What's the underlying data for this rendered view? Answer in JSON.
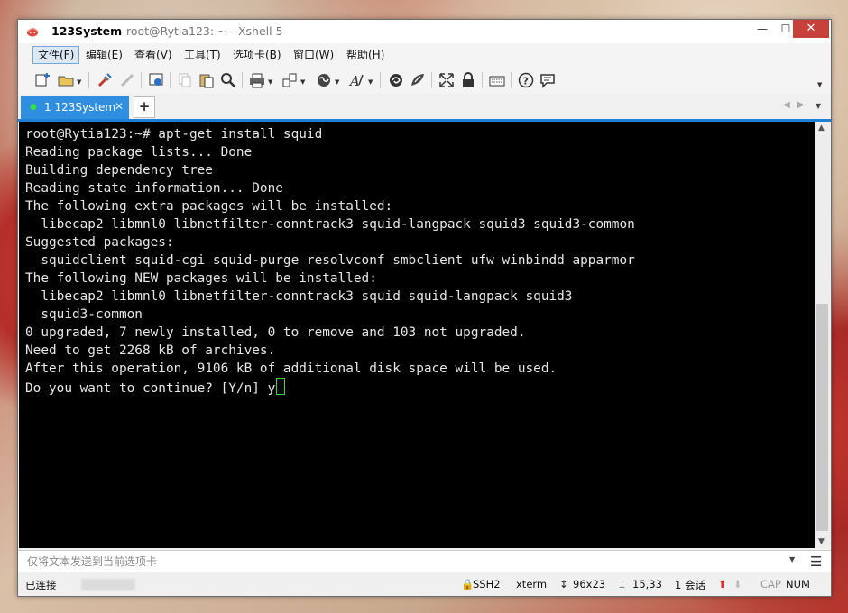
{
  "window": {
    "app_name": "123System",
    "title": "root@Rytia123: ~ - Xshell 5",
    "controls": {
      "minimize": "—",
      "maximize": "☐",
      "close": "✕"
    }
  },
  "menu": [
    {
      "label": "文件(F)",
      "active": true
    },
    {
      "label": "编辑(E)"
    },
    {
      "label": "查看(V)"
    },
    {
      "label": "工具(T)"
    },
    {
      "label": "选项卡(B)"
    },
    {
      "label": "窗口(W)"
    },
    {
      "label": "帮助(H)"
    }
  ],
  "toolbar_icons": [
    "new-session-icon",
    "open-folder-icon",
    "reconnect-icon",
    "disconnect-icon",
    "session-properties-icon",
    "copy-icon",
    "paste-icon",
    "find-icon",
    "print-icon",
    "transfer-icon",
    "globe-icon",
    "font-icon",
    "xftp-icon",
    "xmanager-icon",
    "fullscreen-icon",
    "lock-icon",
    "keyboard-icon",
    "help-icon",
    "chat-icon"
  ],
  "tabs": [
    {
      "label": "1 123System",
      "status_color": "#35e04a",
      "active": true
    }
  ],
  "tab_add": "+",
  "terminal": {
    "lines": [
      "root@Rytia123:~# apt-get install squid",
      "Reading package lists... Done",
      "Building dependency tree",
      "Reading state information... Done",
      "The following extra packages will be installed:",
      "  libecap2 libmnl0 libnetfilter-conntrack3 squid-langpack squid3 squid3-common",
      "Suggested packages:",
      "  squidclient squid-cgi squid-purge resolvconf smbclient ufw winbindd apparmor",
      "The following NEW packages will be installed:",
      "  libecap2 libmnl0 libnetfilter-conntrack3 squid squid-langpack squid3",
      "  squid3-common",
      "0 upgraded, 7 newly installed, 0 to remove and 103 not upgraded.",
      "Need to get 2268 kB of archives.",
      "After this operation, 9106 kB of additional disk space will be used.",
      "Do you want to continue? [Y/n] y"
    ],
    "background": "#000000",
    "foreground": "#e6e6e6",
    "cursor_color": "#3bd43b"
  },
  "compose": {
    "placeholder": "仅将文本发送到当前选项卡"
  },
  "status": {
    "connection": "已连接",
    "protocol": "SSH2",
    "terminal_type": "xterm",
    "size": "96x23",
    "cursor_pos": "15,33",
    "sessions": "1 会话",
    "cap": "CAP",
    "num": "NUM"
  },
  "colors": {
    "accent": "#2f8ee0",
    "tab_underline": "#1e7fd8",
    "close": "#c7403a"
  }
}
